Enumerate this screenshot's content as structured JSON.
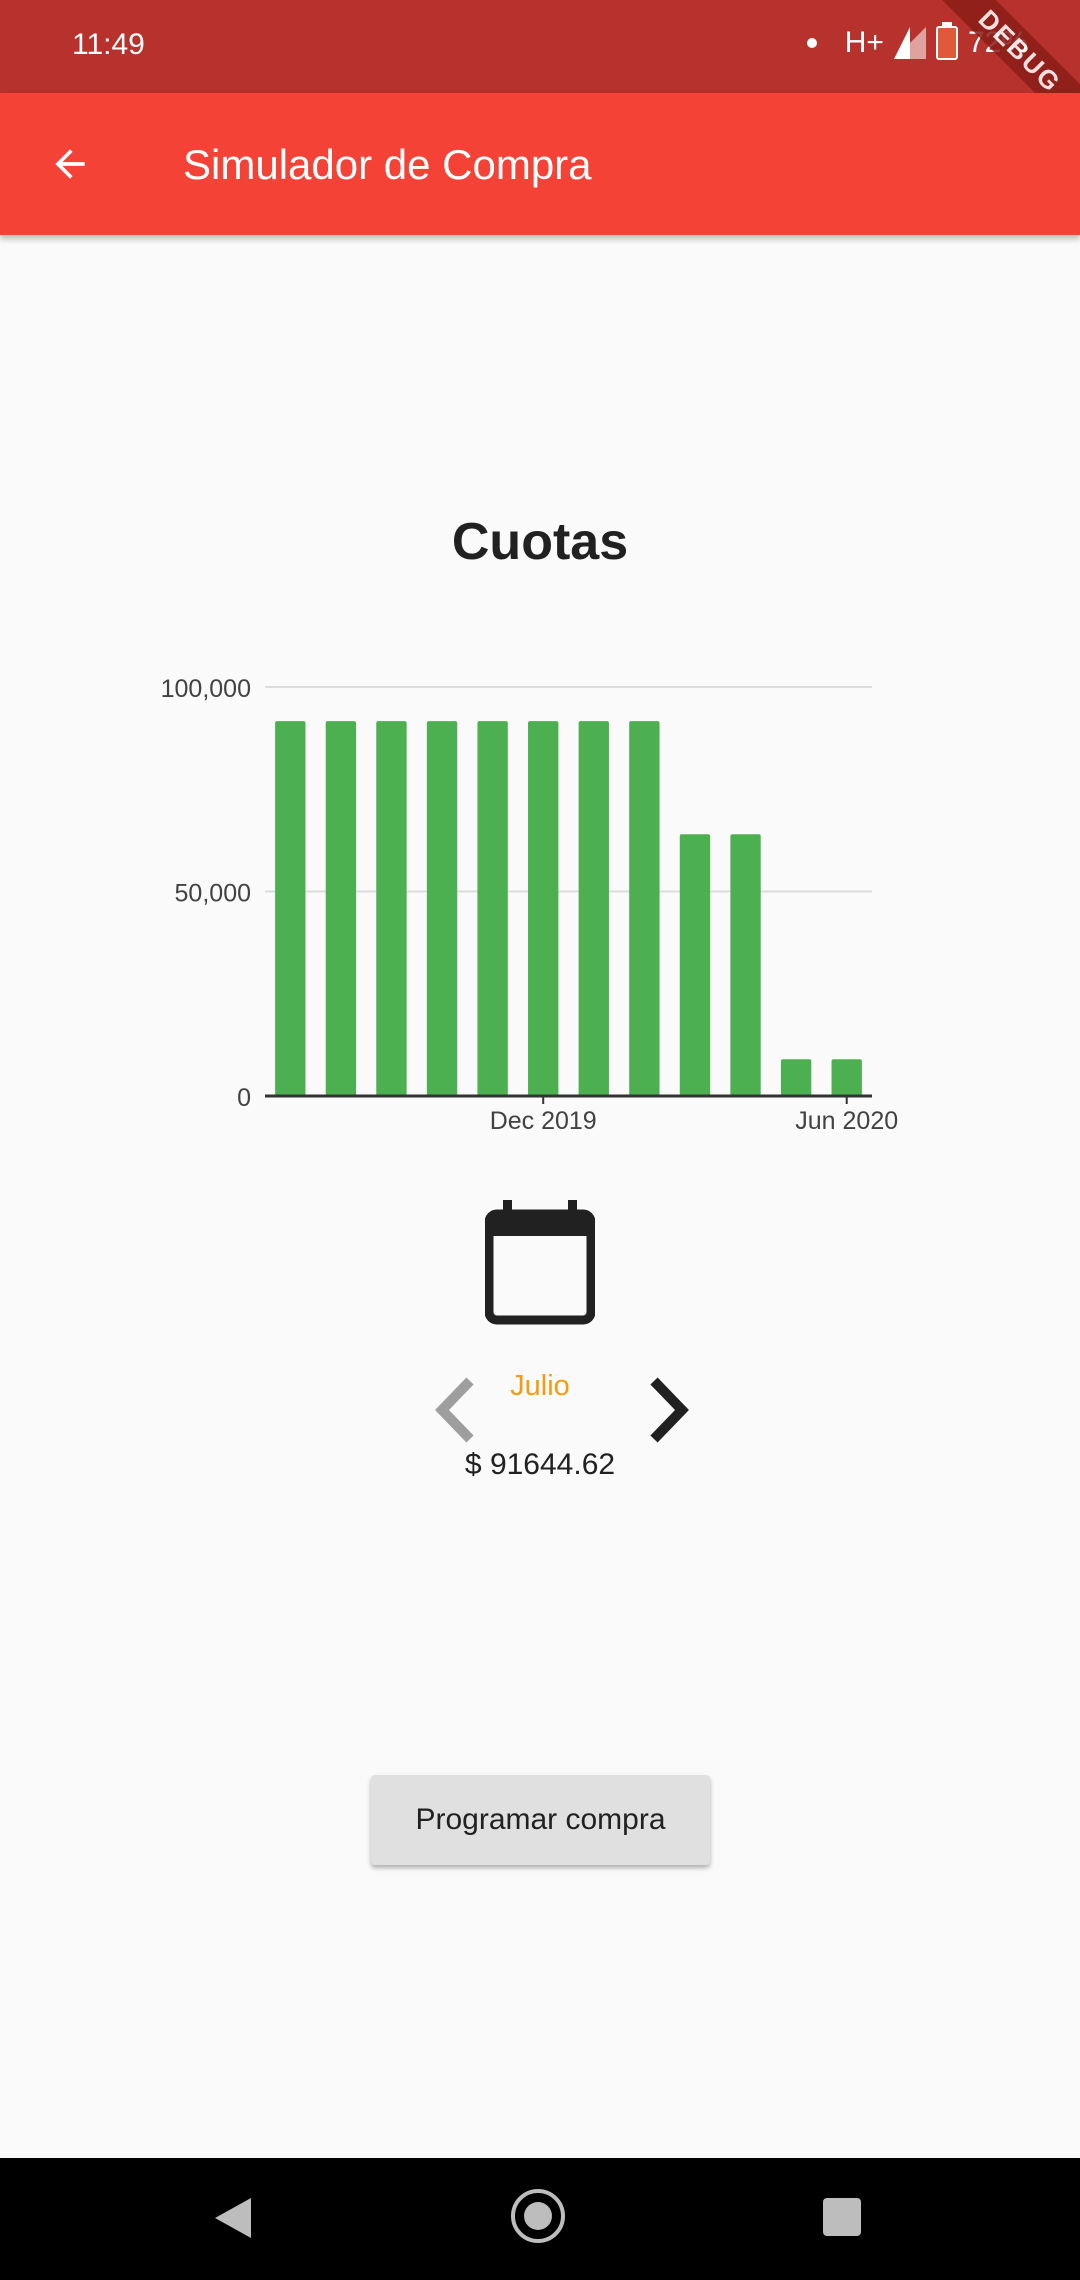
{
  "status_bar": {
    "time": "11:49",
    "network": "H+",
    "battery": "72%",
    "debug_label": "DEBUG"
  },
  "app_bar": {
    "back_icon": "arrow-back-icon",
    "title": "Simulador de Compra"
  },
  "chart_data": {
    "type": "bar",
    "title": "Cuotas",
    "color": "#4caf50",
    "values": [
      91644.62,
      91644.62,
      91644.62,
      91644.62,
      91644.62,
      91644.62,
      91644.62,
      91644.62,
      64000,
      64000,
      9000,
      9000
    ],
    "x_ticks": [
      {
        "label": "Dec 2019",
        "index": 5
      },
      {
        "label": "Jun 2020",
        "index": 11
      }
    ],
    "y_ticks": [
      {
        "label": "0",
        "value": 0
      },
      {
        "label": "50,000",
        "value": 50000
      },
      {
        "label": "100,000",
        "value": 100000
      }
    ],
    "ylim": [
      0,
      100000
    ],
    "grid": true
  },
  "selector": {
    "calendar_icon": "calendar-icon",
    "month": "Julio",
    "amount": "$ 91644.62",
    "prev_icon": "chevron-left-icon",
    "next_icon": "chevron-right-icon"
  },
  "actions": {
    "program_button": "Programar compra"
  },
  "nav_bar": {
    "back": "nav-back-icon",
    "home": "nav-home-icon",
    "recent": "nav-recent-icon"
  }
}
